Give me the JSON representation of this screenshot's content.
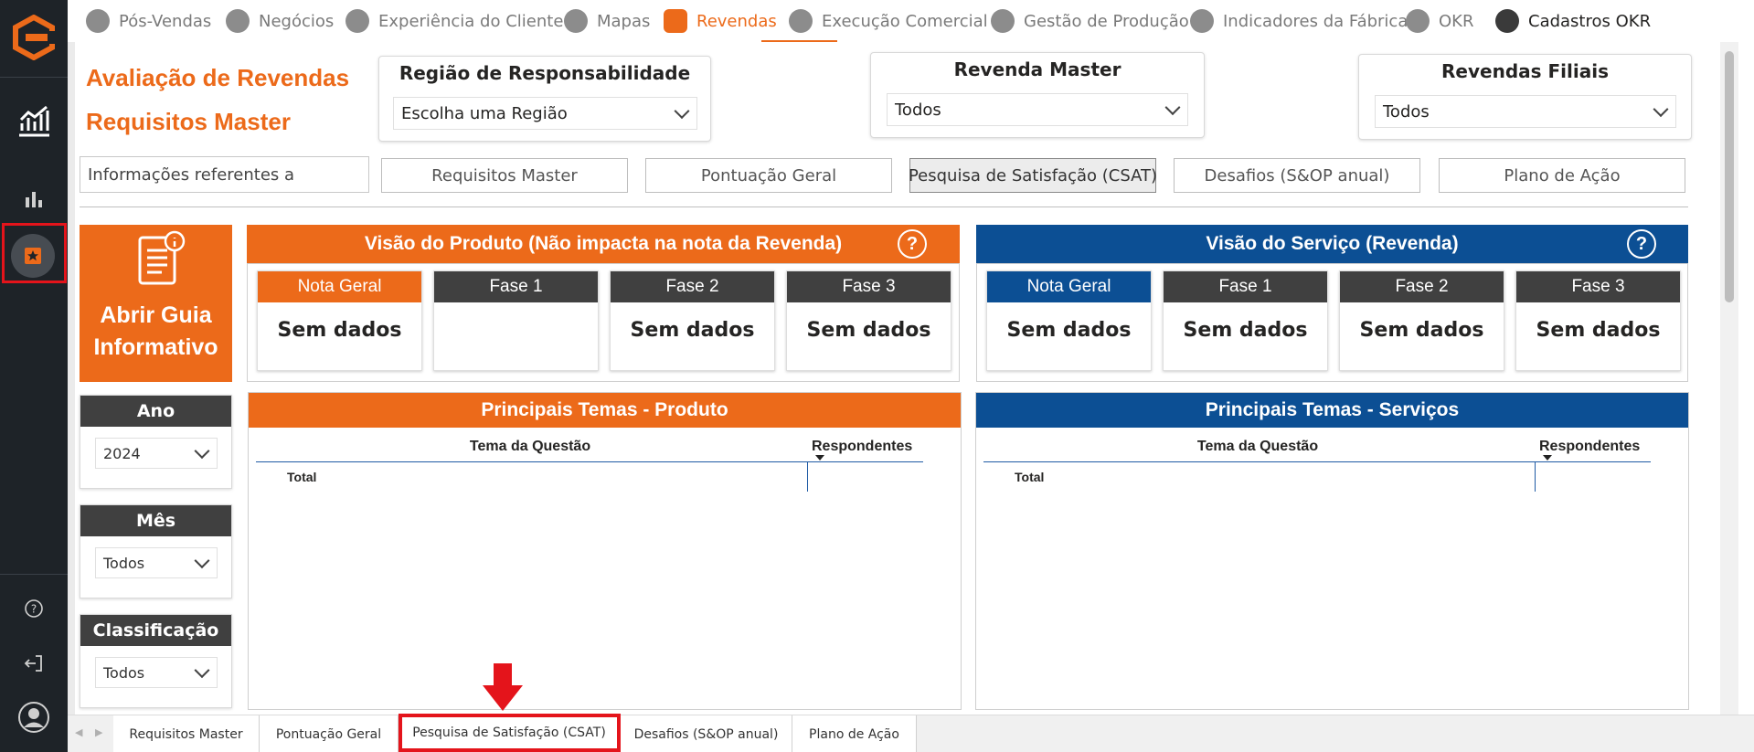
{
  "nav": {
    "items": [
      {
        "label": "Pós-Vendas",
        "icon": "person-icon"
      },
      {
        "label": "Negócios",
        "icon": "handshake-icon"
      },
      {
        "label": "Experiência do Cliente",
        "icon": "person-icon"
      },
      {
        "label": "Mapas",
        "icon": "map-person-icon"
      },
      {
        "label": "Revendas",
        "icon": "store-icon",
        "active": true
      },
      {
        "label": "Execução Comercial",
        "icon": "clock-icon"
      },
      {
        "label": "Gestão de Produção",
        "icon": "factory-person-icon"
      },
      {
        "label": "Indicadores da Fábrica",
        "icon": "factory-icon"
      },
      {
        "label": "OKR",
        "icon": "target-icon"
      },
      {
        "label": "Cadastros OKR",
        "icon": "user-icon"
      }
    ]
  },
  "header": {
    "title_line1": "Avaliação de Revendas",
    "title_line2": "Requisitos Master"
  },
  "slicers": {
    "regiao": {
      "title": "Região de Responsabilidade",
      "value": "Escolha uma Região"
    },
    "revenda_master": {
      "title": "Revenda Master",
      "value": "Todos"
    },
    "revendas_filiais": {
      "title": "Revendas Filiais",
      "value": "Todos"
    }
  },
  "info_label": "Informações referentes a",
  "tabs": [
    "Requisitos Master",
    "Pontuação Geral",
    "Pesquisa de Satisfação (CSAT)",
    "Desafios (S&OP anual)",
    "Plano de Ação"
  ],
  "guide": {
    "line1": "Abrir Guia",
    "line2": "Informativo"
  },
  "left_slicers": {
    "ano": {
      "title": "Ano",
      "value": "2024"
    },
    "mes": {
      "title": "Mês",
      "value": "Todos"
    },
    "classificacao": {
      "title": "Classificação",
      "value": "Todos"
    }
  },
  "produto": {
    "header": "Visão do Produto (Não impacta na nota da Revenda)",
    "help": "?",
    "kpis": [
      {
        "label": "Nota Geral",
        "value": "Sem dados"
      },
      {
        "label": "Fase 1",
        "value": ""
      },
      {
        "label": "Fase 2",
        "value": "Sem dados"
      },
      {
        "label": "Fase 3",
        "value": "Sem dados"
      }
    ],
    "temas_title": "Principais Temas - Produto"
  },
  "servico": {
    "header": "Visão do Serviço (Revenda)",
    "help": "?",
    "kpis": [
      {
        "label": "Nota Geral",
        "value": "Sem dados"
      },
      {
        "label": "Fase 1",
        "value": "Sem dados"
      },
      {
        "label": "Fase 2",
        "value": "Sem dados"
      },
      {
        "label": "Fase 3",
        "value": "Sem dados"
      }
    ],
    "temas_title": "Principais Temas - Serviços"
  },
  "table": {
    "col1": "Tema da Questão",
    "col2": "Respondentes",
    "total": "Total"
  },
  "page_tabs": [
    "Requisitos Master",
    "Pontuação Geral",
    "Pesquisa de Satisfação (CSAT)",
    "Desafios (S&OP anual)",
    "Plano de Ação"
  ],
  "colors": {
    "orange": "#ec6a1a",
    "blue": "#0c4f94",
    "dark": "#404040",
    "sidebar": "#1e2328",
    "highlight": "#e4141b"
  }
}
